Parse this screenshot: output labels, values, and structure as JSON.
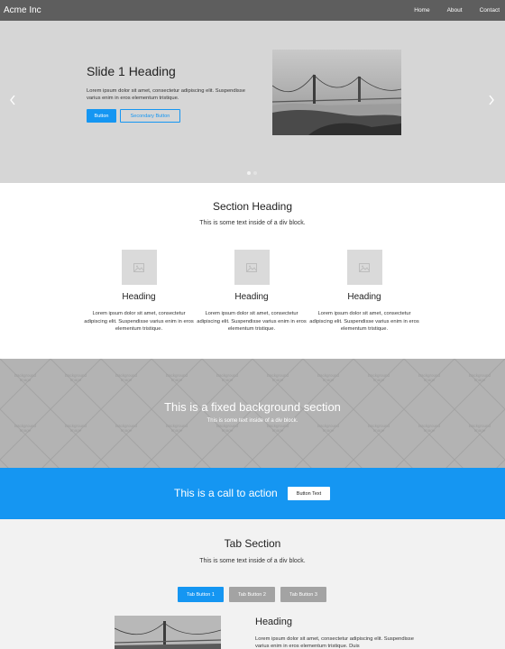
{
  "nav": {
    "brand": "Acme Inc",
    "links": [
      "Home",
      "About",
      "Contact"
    ]
  },
  "slider": {
    "heading": "Slide 1 Heading",
    "text": "Lorem ipsum dolor sit amet, consectetur adipiscing elit. Suspendisse varius enim in eros elementum tristique.",
    "primary_button": "Button",
    "secondary_button": "Secondary Button",
    "prev_icon": "chevron-left-icon",
    "next_icon": "chevron-right-icon",
    "active_slide": 1,
    "slide_count": 2
  },
  "section": {
    "heading": "Section Heading",
    "subtitle": "This is some text inside of a div block.",
    "columns": [
      {
        "heading": "Heading",
        "text": "Lorem ipsum dolor sit amet, consectetur adipiscing elit. Suspendisse varius enim in eros elementum tristique."
      },
      {
        "heading": "Heading",
        "text": "Lorem ipsum dolor sit amet, consectetur adipiscing elit. Suspendisse varius enim in eros elementum tristique."
      },
      {
        "heading": "Heading",
        "text": "Lorem ipsum dolor sit amet, consectetur adipiscing elit. Suspendisse varius enim in eros elementum tristique."
      }
    ]
  },
  "fixed_section": {
    "heading": "This is a fixed background section",
    "subtitle": "This is some text inside of a div block.",
    "pattern_label": "Background Image"
  },
  "cta": {
    "text": "This is a call to action",
    "button": "Button Text"
  },
  "tabs": {
    "heading": "Tab Section",
    "subtitle": "This is some text inside of a div block.",
    "buttons": [
      "Tab Button 1",
      "Tab Button 2",
      "Tab Button 3"
    ],
    "active_index": 0,
    "content_heading": "Heading",
    "content_text": "Lorem ipsum dolor sit amet, consectetur adipiscing elit. Suspendisse varius enim in eros elementum tristique. Duis"
  },
  "colors": {
    "accent": "#1596f2",
    "nav_bg": "#5e5e5e",
    "slider_bg": "#d6d6d6",
    "fixed_bg": "#b3b3b3",
    "tabs_bg": "#f2f2f2",
    "tab_inactive": "#a3a3a3"
  }
}
